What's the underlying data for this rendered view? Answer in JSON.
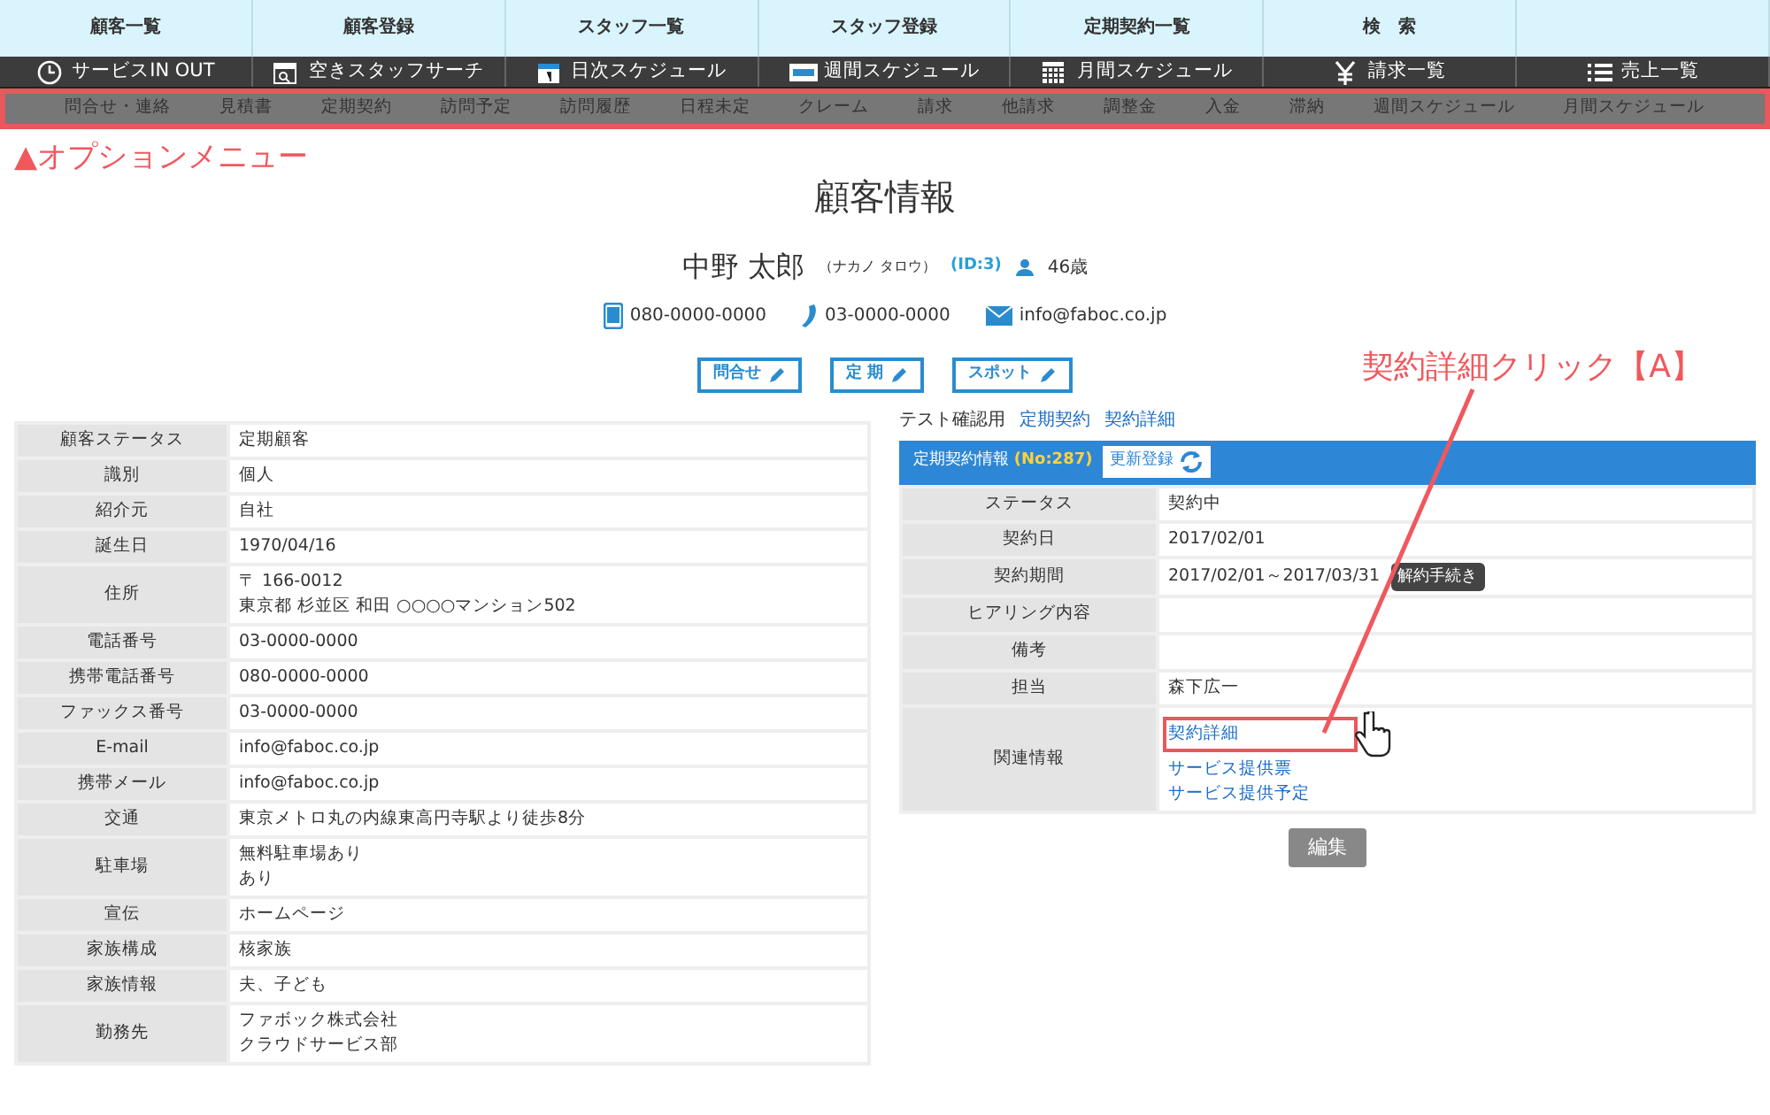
{
  "nav_top": [
    "顧客一覧",
    "顧客登録",
    "スタッフ一覧",
    "スタッフ登録",
    "定期契約一覧",
    "検　索"
  ],
  "nav_main": [
    "サービスIN OUT",
    "空きスタッフサーチ",
    "日次スケジュール",
    "週間スケジュール",
    "月間スケジュール",
    "請求一覧",
    "売上一覧"
  ],
  "option_menu": [
    "問合せ・連絡",
    "見積書",
    "定期契約",
    "訪問予定",
    "訪問履歴",
    "日程未定",
    "クレーム",
    "請求",
    "他請求",
    "調整金",
    "入金",
    "滞納",
    "週間スケジュール",
    "月間スケジュール"
  ],
  "option_menu_annotation": "▲オプションメニュー",
  "page_title": "顧客情報",
  "customer": {
    "name": "中野 太郎",
    "kana": "（ナカノ タロウ）",
    "id": "(ID:3)",
    "age": "46歳",
    "mobile": "080-0000-0000",
    "phone": "03-0000-0000",
    "email": "info@faboc.co.jp"
  },
  "action_buttons": [
    "問合せ",
    "定 期",
    "スポット"
  ],
  "info_table": [
    {
      "label": "顧客ステータス",
      "values": [
        "定期顧客"
      ]
    },
    {
      "label": "識別",
      "values": [
        "個人"
      ]
    },
    {
      "label": "紹介元",
      "values": [
        "自社"
      ]
    },
    {
      "label": "誕生日",
      "values": [
        "1970/04/16"
      ]
    },
    {
      "label": "住所",
      "values": [
        "〒 166-0012",
        "東京都 杉並区 和田 ○○○○マンション502"
      ]
    },
    {
      "label": "電話番号",
      "values": [
        "03-0000-0000"
      ]
    },
    {
      "label": "携帯電話番号",
      "values": [
        "080-0000-0000"
      ]
    },
    {
      "label": "ファックス番号",
      "values": [
        "03-0000-0000"
      ]
    },
    {
      "label": "E-mail",
      "values": [
        "info@faboc.co.jp"
      ]
    },
    {
      "label": "携帯メール",
      "values": [
        "info@faboc.co.jp"
      ]
    },
    {
      "label": "交通",
      "values": [
        "東京メトロ丸の内線東高円寺駅より徒歩8分"
      ]
    },
    {
      "label": "駐車場",
      "values": [
        "無料駐車場あり",
        "あり"
      ]
    },
    {
      "label": "宣伝",
      "values": [
        "ホームページ"
      ]
    },
    {
      "label": "家族構成",
      "values": [
        "核家族"
      ]
    },
    {
      "label": "家族情報",
      "values": [
        "夫、子ども"
      ]
    },
    {
      "label": "勤務先",
      "values": [
        "ファボック株式会社",
        "クラウドサービス部"
      ]
    }
  ],
  "contract_links": [
    {
      "text": "テスト確認用",
      "kind": "text"
    },
    {
      "text": "定期契約",
      "kind": "link"
    },
    {
      "text": "契約詳細",
      "kind": "link"
    }
  ],
  "contract": {
    "header": "定期契約情報",
    "number": "(No:287)",
    "renew_button": "更新登録",
    "rows": [
      {
        "label": "ステータス",
        "kind": "text",
        "values": [
          "契約中"
        ]
      },
      {
        "label": "契約日",
        "kind": "text",
        "values": [
          "2017/02/01"
        ]
      },
      {
        "label": "契約期間",
        "kind": "text",
        "values": [
          "2017/02/01～2017/03/31"
        ],
        "badge": "解約手続き"
      },
      {
        "label": "ヒアリング内容",
        "kind": "text",
        "values": []
      },
      {
        "label": "備考",
        "kind": "text",
        "values": []
      },
      {
        "label": "担当",
        "kind": "text",
        "values": [
          "森下広一"
        ]
      },
      {
        "label": "関連情報",
        "kind": "links",
        "links": [
          {
            "text": "契約詳細",
            "highlighted": true
          },
          {
            "text": "サービス提供票",
            "highlighted": false
          },
          {
            "text": "サービス提供予定",
            "highlighted": false
          }
        ]
      }
    ]
  },
  "edit_button": "編集",
  "click_annotation": "契約詳細クリック【A】"
}
